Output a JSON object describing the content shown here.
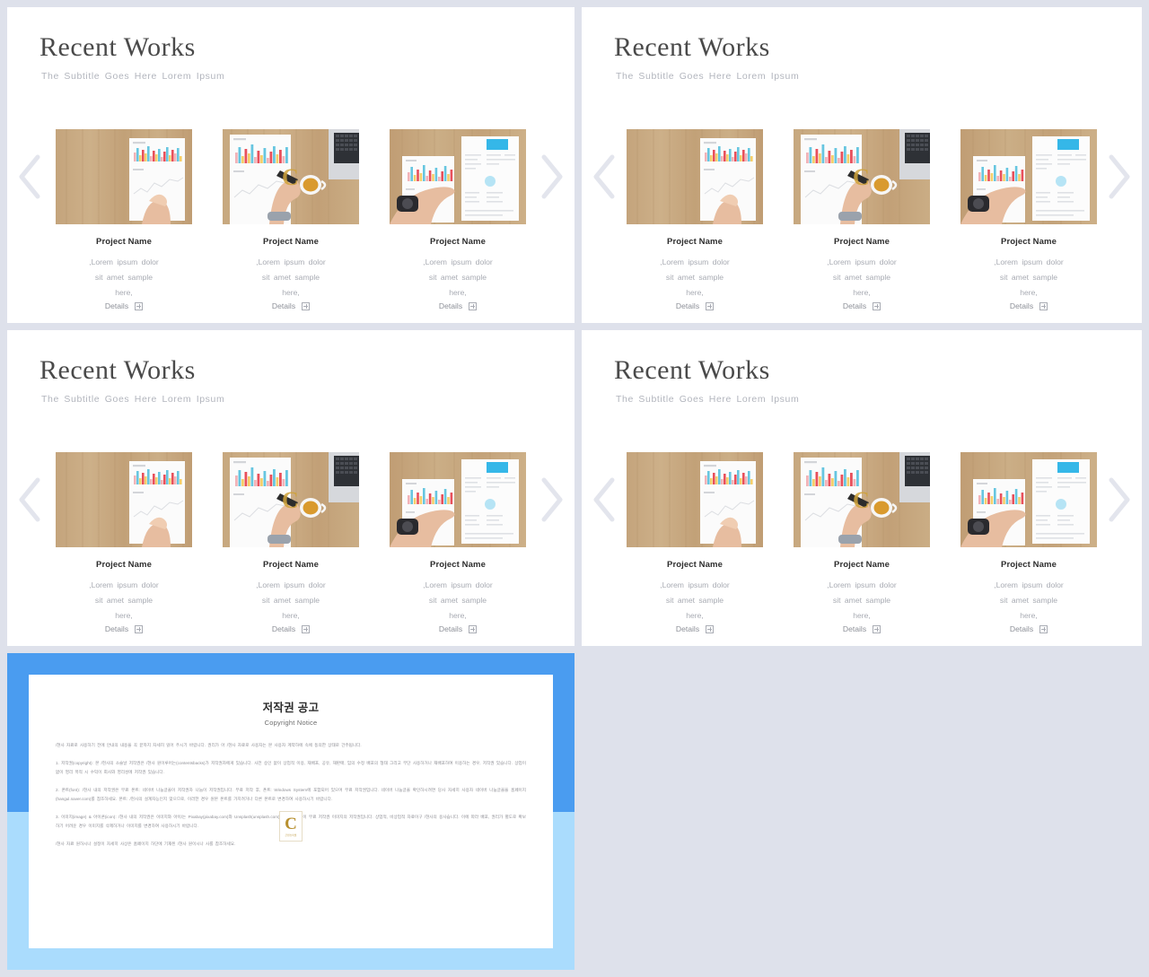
{
  "background_color": "#dee1eb",
  "slide": {
    "title": "Recent Works",
    "subtitle": "The Subtitle Goes Here Lorem Ipsum",
    "nav": {
      "prev_label": "previous-slide",
      "next_label": "next-slide"
    },
    "cards": [
      {
        "title": "Project Name",
        "desc_line1": ",Lorem ipsum dolor",
        "desc_line2": "sit amet sample",
        "desc_line3": "here,",
        "details_label": "Details",
        "image_alt": "hand pointing at printed bar chart on wooden desk"
      },
      {
        "title": "Project Name",
        "desc_line1": ",Lorem ipsum dolor",
        "desc_line2": "sit amet sample",
        "desc_line3": "here,",
        "details_label": "Details",
        "image_alt": "hand with pen marking chart next to coffee cup and laptop"
      },
      {
        "title": "Project Name",
        "desc_line1": ",Lorem ipsum dolor",
        "desc_line2": "sit amet sample",
        "desc_line3": "here,",
        "details_label": "Details",
        "image_alt": "hand with wristwatch pointing at chart beside blue-header report"
      }
    ]
  },
  "copyright": {
    "frame_color_top": "#4a9cf0",
    "frame_color_bottom": "#aadcfd",
    "title_ko": "저작권 공고",
    "title_en": "Copyright Notice",
    "paragraphs": [
      "/현사 자료로 사용하기 전에 안내의 내용을 꼭 끝까지 자세히 읽어 주시기 바랍니다. 권리가 아 /현사 자료로 사용자는 본 사용자 계약하에 속에 동의한 상태로 간주됩니다.",
      "1. 저작권(copyright): 본 /현사의 소슬날 저작권은 /현사 원이루어는(contentsbacks)가 저작권자에게 있습니다. 사전 승인 없이 상업적 이용, 재배포, 공유, 재판매, 임의 수정 배포의 형태 그리고 무단 사용하거나 재배포하여 이용하는 경우, 저작권 있습니다. 상업이 없이 영리 목적 시 수익이 회사와 영리성에 저작권 있습니다.",
      "2. 폰트(font): /현사 내의 저작권은 무료 폰트: 네이버 나눔글꼴이 저작권자 나눔이 저작권입니다. 무료 저작 후, 폰트: Windows System에 포함되어 있으며 무료 저작권입니다. 네이버 나눔글꼴 확인하시려면 당사 자세히 사용자 네이버 나눔글꼴을 홈페이지(hangul.naver.com)를 참조하세요. 폰트: /현사의 설계자능인지 맞으므로, 이러한 경우 원본 폰트를 가지려거나 다른 폰트로 변경하여 사용하시기 바랍니다.",
      "3. 이미지(image) & 아이콘(icon): /현사 내의 저작권은 이미지와 아이/는 Pixabay(pixabay.com)와 Unsplash(unsplash.com) 등에서 자유이 무료 저작권 이미지의 저작권입니다. 상업적, 비상업적 자료이구 /현사의 용사습니다. 이에 따라 배포, 권리가 별도로 확보하기 어려운 경우 이미지를 삭제하거나 이미지를 변경하여 사용하시기 바랍니다.",
      "/현사 자료 원하시나 설정이 자세히 사상은 홈페이지 하단에 기재된 /현사 원이시나 사를 참조하세요."
    ],
    "watermark": {
      "letter": "C",
      "caption": "콘텐츠마켓"
    }
  }
}
